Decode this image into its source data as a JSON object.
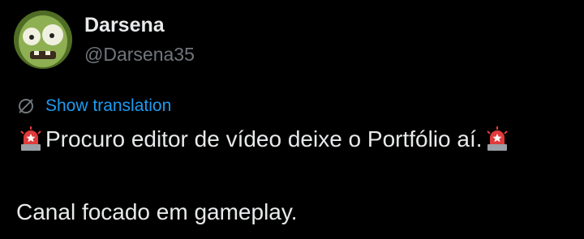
{
  "author": {
    "display_name": "Darsena",
    "handle": "@Darsena35",
    "avatar_icon": "zombie-avatar"
  },
  "translation": {
    "label": "Show translation",
    "icon": "globe-slash-icon"
  },
  "tweet": {
    "line1": "Procuro editor de vídeo deixe o Portfólio aí.",
    "line2": "Canal focado em gameplay.",
    "emoji_icon": "police-siren-icon"
  },
  "colors": {
    "background": "#000000",
    "primary_text": "#e7e9ea",
    "secondary_text": "#71767b",
    "link": "#1d9bf0",
    "siren_red": "#e03a3a"
  }
}
